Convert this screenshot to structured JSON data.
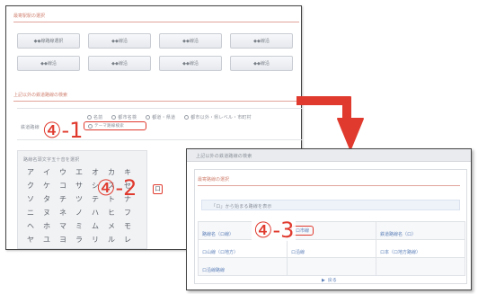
{
  "annotations": {
    "step1": "④-1",
    "step2": "④-2",
    "step3": "④-3"
  },
  "screen1": {
    "title": "最寄駅駅の選択",
    "buttons": [
      "◆◆線路線選択",
      "◆◆線沿",
      "◆◆線沿",
      "◆◆線沿",
      "◆◆線沿",
      "◆◆線沿",
      "◆◆線沿",
      "◆◆線沿"
    ],
    "subtitle": "上記以外の鉄道路線の検索",
    "radio_label": "鉄道路線",
    "radio_options": [
      "名前",
      "都市名検",
      "都道・県道",
      "都市以外・県レベル・市町村"
    ],
    "radio_selected": "テーマ路線検索",
    "kana_title": "路線名頭文字五十音を選択",
    "kana_rows": [
      [
        "ア",
        "イ",
        "ウ",
        "エ",
        "オ",
        "カ",
        "キ"
      ],
      [
        "ク",
        "ケ",
        "コ",
        "サ",
        "シ",
        "ス",
        "セ"
      ],
      [
        "ソ",
        "タ",
        "チ",
        "ツ",
        "テ",
        "ト",
        "ナ"
      ],
      [
        "ニ",
        "ヌ",
        "ネ",
        "ノ",
        "ハ",
        "ヒ",
        "フ"
      ],
      [
        "ヘ",
        "ホ",
        "マ",
        "ミ",
        "ム",
        "メ",
        "モ"
      ],
      [
        "ヤ",
        "ユ",
        "ヨ",
        "ラ",
        "リ",
        "ル",
        "レ"
      ]
    ],
    "kana_target": "ロ"
  },
  "screen2": {
    "topbar": "上記以外の鉄道路線の検索",
    "subtitle": "最寄路線の選択",
    "note": "「ロ」から始まる路線を表示",
    "table": [
      [
        "路線名（ロ線）",
        "ロ市線",
        "鉄道路線名（ロ）"
      ],
      [
        "ロ山線（ロ地方）",
        "ロ沿線",
        "ロ本（ロ地方路線）"
      ],
      [
        "ロ沿線路線",
        "",
        ""
      ]
    ],
    "footer": "戻る"
  },
  "colors": {
    "accent_red": "#e03a2e",
    "link_blue": "#5b7fb8"
  }
}
